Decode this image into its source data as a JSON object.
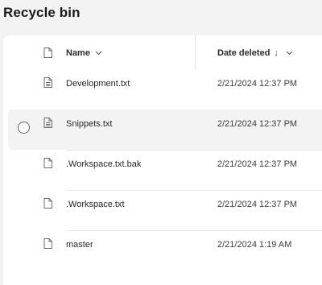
{
  "page": {
    "title": "Recycle bin"
  },
  "header": {
    "file_type_icon": "file-icon",
    "name_label": "Name",
    "name_sort_icon": "chevron-down-icon",
    "date_label": "Date deleted",
    "date_sort_arrow": "↓",
    "date_menu_icon": "chevron-down-icon"
  },
  "rows": [
    {
      "name": "Development.txt",
      "date": "2/21/2024 12:37 PM",
      "icon": "text-file-icon",
      "selected": false
    },
    {
      "name": "Snippets.txt",
      "date": "2/21/2024 12:37 PM",
      "icon": "text-file-icon",
      "selected": true
    },
    {
      "name": ".Workspace.txt.bak",
      "date": "2/21/2024 12:37 PM",
      "icon": "file-icon",
      "selected": false
    },
    {
      "name": ".Workspace.txt",
      "date": "2/21/2024 12:37 PM",
      "icon": "file-icon",
      "selected": false
    },
    {
      "name": "master",
      "date": "2/21/2024 1:19 AM",
      "icon": "file-icon",
      "selected": false
    }
  ],
  "colors": {
    "background": "#f3f3f3",
    "card": "#ffffff",
    "selected_row": "#f3f3f3"
  }
}
